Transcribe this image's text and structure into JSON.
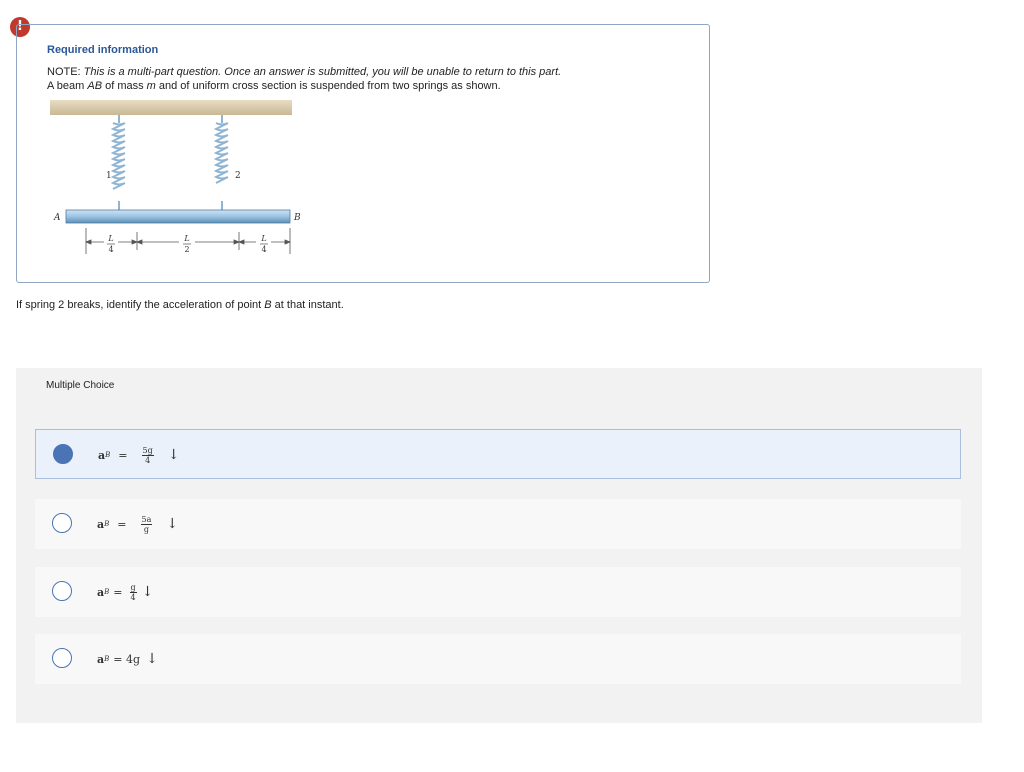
{
  "alert": {
    "icon": "exclamation-icon",
    "glyph": "!"
  },
  "info": {
    "title": "Required information",
    "note_prefix": "NOTE: ",
    "note_italic": "This is a multi-part question. Once an answer is submitted, you will be unable to return to this part.",
    "desc_1": "A beam ",
    "desc_ab": "AB",
    "desc_2": " of mass ",
    "desc_m": "m",
    "desc_3": " and of uniform cross section is suspended from two springs as shown."
  },
  "figure": {
    "label_a": "A",
    "label_b": "B",
    "spring_1": "1",
    "spring_2": "2",
    "dim_1_num": "L",
    "dim_1_den": "4",
    "dim_2_num": "L",
    "dim_2_den": "2",
    "dim_3_num": "L",
    "dim_3_den": "4"
  },
  "question": {
    "text_1": "If spring 2 breaks, identify the acceleration of point ",
    "text_b": "B",
    "text_2": " at that instant."
  },
  "multiple_choice": {
    "label": "Multiple Choice",
    "options": [
      {
        "lhs": "a",
        "sub": "B",
        "eq": "=",
        "num": "5g",
        "den": "4",
        "arrow": "↓",
        "selected": true
      },
      {
        "lhs": "a",
        "sub": "B",
        "eq": "=",
        "num": "5a",
        "den": "g",
        "arrow": "↓",
        "selected": false
      },
      {
        "lhs": "a",
        "sub": "B",
        "eq": "=",
        "num": "g",
        "den": "4",
        "arrow": "↓",
        "selected": false
      },
      {
        "lhs": "a",
        "sub": "B",
        "eq": "= 4g",
        "arrow": "↓",
        "selected": false
      }
    ]
  },
  "colors": {
    "accent": "#4a74b5",
    "alert": "#c0392b",
    "title": "#2b5797"
  }
}
